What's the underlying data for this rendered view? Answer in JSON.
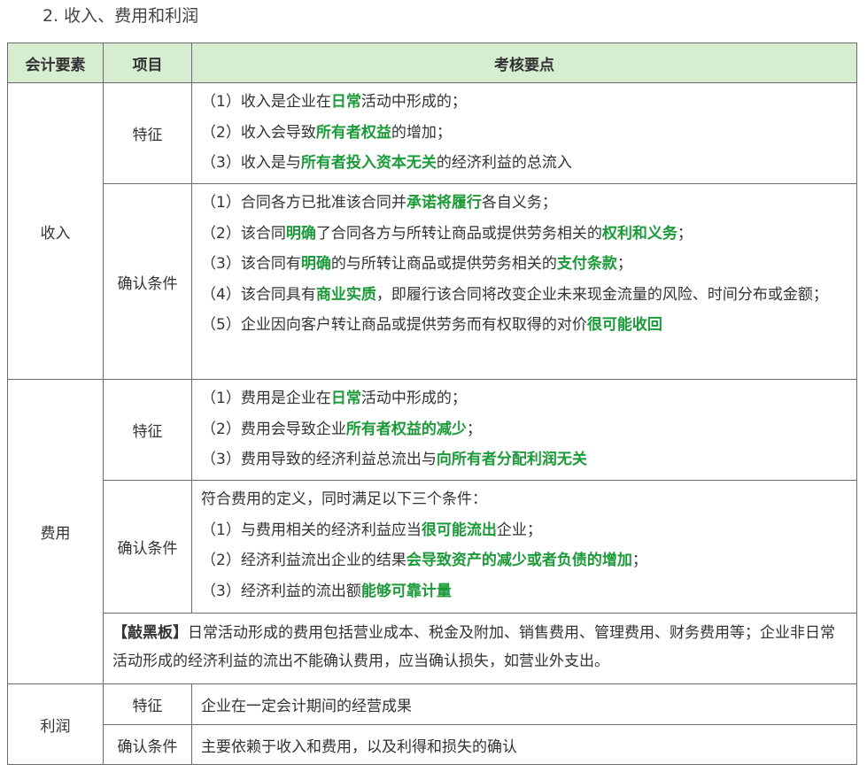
{
  "section_title": "2. 收入、费用和利润",
  "headers": [
    "会计要素",
    "项目",
    "考核要点"
  ],
  "revenue": {
    "element": "收入",
    "feature": {
      "item": "特征",
      "lines": [
        [
          {
            "t": "（1）收入是企业在"
          },
          {
            "t": "日常",
            "k": 1
          },
          {
            "t": "活动中形成的；"
          }
        ],
        [
          {
            "t": "（2）收入会导致"
          },
          {
            "t": "所有者权益",
            "k": 1
          },
          {
            "t": "的增加；"
          }
        ],
        [
          {
            "t": "（3）收入是与"
          },
          {
            "t": "所有者投入资本无关",
            "k": 1
          },
          {
            "t": "的经济利益的总流入"
          }
        ]
      ]
    },
    "conditions": {
      "item": "确认条件",
      "lines": [
        [
          {
            "t": "（1）合同各方已批准该合同并"
          },
          {
            "t": "承诺将履行",
            "k": 1
          },
          {
            "t": "各自义务；"
          }
        ],
        [
          {
            "t": "（2）该合同"
          },
          {
            "t": "明确",
            "k": 1
          },
          {
            "t": "了合同各方与所转让商品或提供劳务相关的"
          },
          {
            "t": "权利和义务",
            "k": 1
          },
          {
            "t": "；"
          }
        ],
        [
          {
            "t": "（3）该合同有"
          },
          {
            "t": "明确",
            "k": 1
          },
          {
            "t": "的与所转让商品或提供劳务相关的"
          },
          {
            "t": "支付条款",
            "k": 1
          },
          {
            "t": "；"
          }
        ],
        [
          {
            "t": "（4）该合同具有"
          },
          {
            "t": "商业实质",
            "k": 1
          },
          {
            "t": "，即履行该合同将改变企业未来现金流量的风险、时间分布或金额；"
          }
        ],
        [
          {
            "t": "（5）企业因向客户转让商品或提供劳务而有权取得的对价"
          },
          {
            "t": "很可能收回",
            "k": 1
          }
        ]
      ]
    }
  },
  "expense": {
    "element": "费用",
    "feature": {
      "item": "特征",
      "lines": [
        [
          {
            "t": "（1）费用是企业在"
          },
          {
            "t": "日常",
            "k": 1
          },
          {
            "t": "活动中形成的；"
          }
        ],
        [
          {
            "t": "（2）费用会导致企业"
          },
          {
            "t": "所有者权益的减少",
            "k": 1
          },
          {
            "t": "；"
          }
        ],
        [
          {
            "t": "（3）费用导致的经济利益总流出与"
          },
          {
            "t": "向所有者分配利润无关",
            "k": 1
          }
        ]
      ]
    },
    "conditions": {
      "item": "确认条件",
      "lines": [
        [
          {
            "t": "符合费用的定义，同时满足以下三个条件："
          }
        ],
        [
          {
            "t": "（1）与费用相关的经济利益应当"
          },
          {
            "t": "很可能流出",
            "k": 1
          },
          {
            "t": "企业；"
          }
        ],
        [
          {
            "t": "（2）经济利益流出企业的结果"
          },
          {
            "t": "会导致资产的减少或者负债的增加",
            "k": 1
          },
          {
            "t": "；"
          }
        ],
        [
          {
            "t": "（3）经济利益的流出额"
          },
          {
            "t": "能够可靠计量",
            "k": 1
          }
        ]
      ]
    },
    "tip": {
      "label": "【敲黑板】",
      "text": "日常活动形成的费用包括营业成本、税金及附加、销售费用、管理费用、财务费用等；企业非日常活动形成的经济利益的流出不能确认费用，应当确认损失，如营业外支出。"
    }
  },
  "profit": {
    "element": "利润",
    "feature": {
      "item": "特征",
      "text": "企业在一定会计期间的经营成果"
    },
    "conditions": {
      "item": "确认条件",
      "text": "主要依赖于收入和费用，以及利得和损失的确认"
    }
  }
}
